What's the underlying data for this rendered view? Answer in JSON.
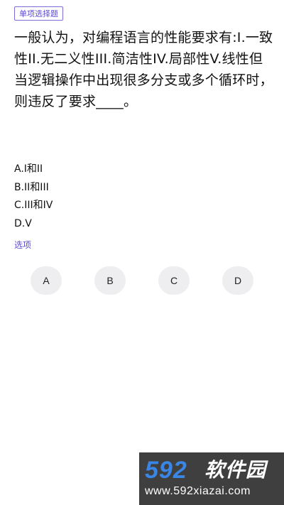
{
  "question_type": "单项选择题",
  "question_text": "一般认为，对编程语言的性能要求有:I.一致性II.无二义性III.简洁性IV.局部性V.线性但当逻辑操作中出现很多分支或多个循环时，则违反了要求____。",
  "options": [
    {
      "label": "A.I和II"
    },
    {
      "label": "B.II和III"
    },
    {
      "label": "C.III和IV"
    },
    {
      "label": "D.V"
    }
  ],
  "choice_section_label": "选项",
  "answer_buttons": [
    {
      "label": "A"
    },
    {
      "label": "B"
    },
    {
      "label": "C"
    },
    {
      "label": "D"
    }
  ],
  "watermark": {
    "logo": "592",
    "brand": "软件园",
    "url": "www.592xiazai.com"
  },
  "colors": {
    "accent": "#5a4ad1",
    "button_bg": "#eeeef0",
    "watermark_bg": "#3f3f3f",
    "watermark_logo": "#3a86e6"
  }
}
